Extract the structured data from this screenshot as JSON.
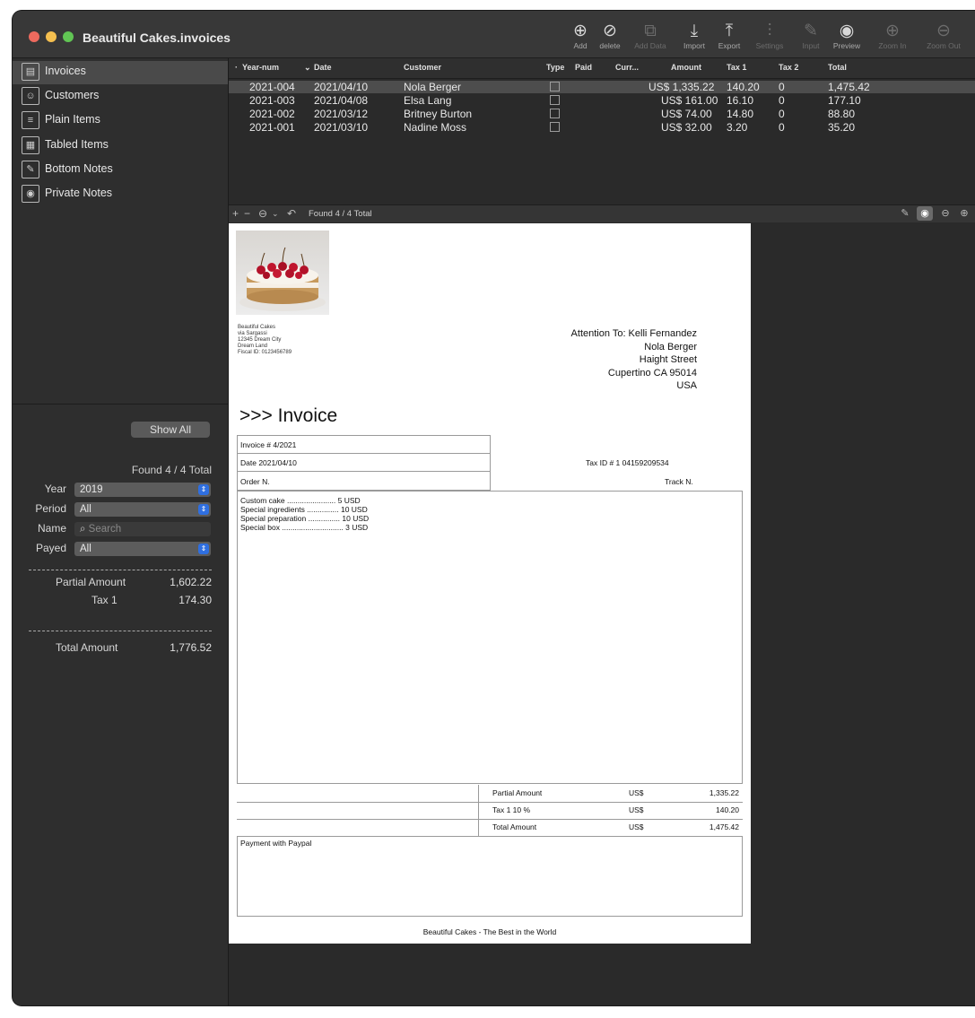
{
  "window": {
    "title": "Beautiful Cakes.invoices"
  },
  "toolbar": {
    "buttons": [
      {
        "label": "Add",
        "icon": "⊕"
      },
      {
        "label": "delete",
        "icon": "⊘"
      },
      {
        "label": "Add Data",
        "icon": "⧉"
      },
      {
        "label": "Import",
        "icon": "⤓"
      },
      {
        "label": "Export",
        "icon": "⤒"
      },
      {
        "label": "Settings",
        "icon": "⫶"
      },
      {
        "label": "Input",
        "icon": "✎"
      },
      {
        "label": "Preview",
        "icon": "◉"
      },
      {
        "label": "Zoom In",
        "icon": "⊕"
      },
      {
        "label": "Zoom Out",
        "icon": "⊖"
      }
    ]
  },
  "sidebar": {
    "items": [
      {
        "label": "Invoices",
        "icon": "▤"
      },
      {
        "label": "Customers",
        "icon": "☺"
      },
      {
        "label": "Plain Items",
        "icon": "≡"
      },
      {
        "label": "Tabled Items",
        "icon": "▦"
      },
      {
        "label": "Bottom Notes",
        "icon": "✎"
      },
      {
        "label": "Private Notes",
        "icon": "◉"
      }
    ],
    "show_all": "Show All",
    "found": "Found 4 / 4 Total",
    "filters": {
      "year_label": "Year",
      "year_value": "2019",
      "period_label": "Period",
      "period_value": "All",
      "name_label": "Name",
      "name_placeholder": "Search",
      "payed_label": "Payed",
      "payed_value": "All"
    },
    "summary": {
      "partial_label": "Partial Amount",
      "partial_value": "1,602.22",
      "tax1_label": "Tax 1",
      "tax1_value": "174.30",
      "total_label": "Total Amount",
      "total_value": "1,776.52"
    }
  },
  "table": {
    "headers": [
      "Year-num",
      "Date",
      "Customer",
      "Type",
      "Paid",
      "Curr...",
      "Amount",
      "Tax 1",
      "Tax 2",
      "Total"
    ],
    "rows": [
      {
        "yearnum": "2021-004",
        "date": "2021/04/10",
        "customer": "Nola Berger",
        "amount": "US$ 1,335.22",
        "tax1": "140.20",
        "tax2": "0",
        "total": "1,475.42"
      },
      {
        "yearnum": "2021-003",
        "date": "2021/04/08",
        "customer": "Elsa Lang",
        "amount": "US$ 161.00",
        "tax1": "16.10",
        "tax2": "0",
        "total": "177.10"
      },
      {
        "yearnum": "2021-002",
        "date": "2021/03/12",
        "customer": "Britney Burton",
        "amount": "US$ 74.00",
        "tax1": "14.80",
        "tax2": "0",
        "total": "88.80"
      },
      {
        "yearnum": "2021-001",
        "date": "2021/03/10",
        "customer": "Nadine Moss",
        "amount": "US$ 32.00",
        "tax1": "3.20",
        "tax2": "0",
        "total": "35.20"
      }
    ]
  },
  "bottombar": {
    "found": "Found 4 / 4 Total"
  },
  "invoice": {
    "sender": [
      "Beautiful Cakes",
      "via Sargassi",
      "12345 Dream City",
      "Dream Land",
      "Fiscal ID: 0123456789"
    ],
    "attention": [
      "Attention To: Kelli Fernandez",
      "Nola Berger",
      "Haight Street",
      "Cupertino CA 95014",
      "USA"
    ],
    "title": ">>> Invoice",
    "number": "Invoice # 4/2021",
    "date": "Date 2021/04/10",
    "tax_id": "Tax ID # 1 04159209534",
    "order": "Order N.",
    "track": "Track N.",
    "items": [
      "Custom cake ....................... 5 USD",
      "Special ingredients ............... 10 USD",
      "Special preparation ............... 10 USD",
      "Special box ............................. 3 USD"
    ],
    "totals": [
      {
        "label": "Partial Amount",
        "cur": "US$",
        "value": "1,335.22"
      },
      {
        "label": "Tax 1 10 %",
        "cur": "US$",
        "value": "140.20"
      },
      {
        "label": "Total Amount",
        "cur": "US$",
        "value": "1,475.42"
      }
    ],
    "payment": "Payment with Paypal",
    "footer": "Beautiful Cakes - The Best in the World"
  }
}
